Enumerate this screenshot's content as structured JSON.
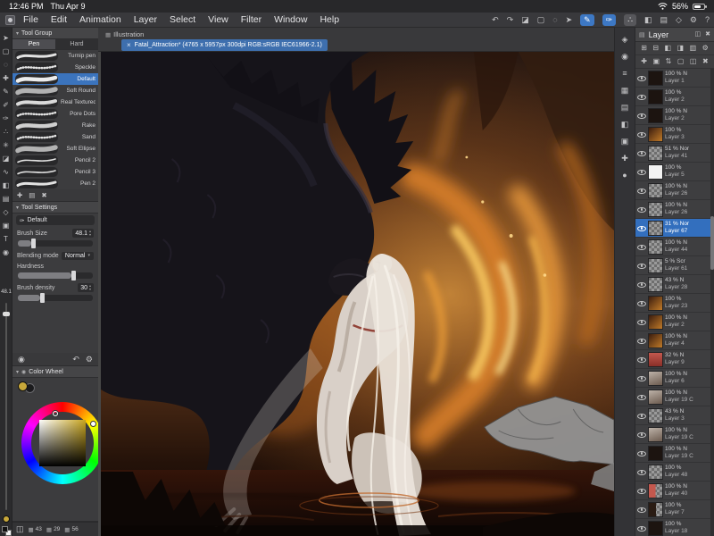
{
  "status_bar": {
    "time": "12:46 PM",
    "date": "Thu Apr 9",
    "battery_percent": "56%"
  },
  "menu_bar": {
    "items": [
      "File",
      "Edit",
      "Animation",
      "Layer",
      "Select",
      "View",
      "Filter",
      "Window",
      "Help"
    ],
    "right_icons": [
      {
        "name": "undo-icon",
        "glyph": "↶",
        "state": ""
      },
      {
        "name": "redo-icon",
        "glyph": "↷",
        "state": ""
      },
      {
        "name": "eraser-toggle-icon",
        "glyph": "◪",
        "state": ""
      },
      {
        "name": "marquee-icon",
        "glyph": "▢",
        "state": ""
      },
      {
        "name": "lasso-icon",
        "glyph": "◌",
        "state": ""
      },
      {
        "name": "object-icon",
        "glyph": "➤",
        "state": ""
      },
      {
        "name": "pen-tool-active-icon",
        "glyph": "✎",
        "state": "active"
      },
      {
        "name": "brush-tool-active-icon",
        "glyph": "✑",
        "state": "active"
      },
      {
        "name": "airbrush-pressed-icon",
        "glyph": "∴",
        "state": "pressed"
      },
      {
        "name": "fill-icon",
        "glyph": "◧",
        "state": ""
      },
      {
        "name": "gradient-icon",
        "glyph": "▤",
        "state": ""
      },
      {
        "name": "figure-icon",
        "glyph": "◇",
        "state": ""
      },
      {
        "name": "settings-gear-icon",
        "glyph": "⚙",
        "state": ""
      },
      {
        "name": "help-circle-icon",
        "glyph": "?",
        "state": ""
      }
    ]
  },
  "tab_strip": {
    "workspace_label": "Illustration",
    "workspace_icon": "▦",
    "doc_tab": {
      "close": "×",
      "title": "Fatal_Attraction* (4765 x 5957px 300dpi RGB:sRGB IEC61966-2.1)"
    }
  },
  "left_toolbar": {
    "tools": [
      {
        "name": "move-tool-icon",
        "glyph": "➤"
      },
      {
        "name": "selection-tool-icon",
        "glyph": "▢"
      },
      {
        "name": "lasso-tool-icon",
        "glyph": "◌"
      },
      {
        "name": "magic-wand-tool-icon",
        "glyph": "✚"
      },
      {
        "name": "pen-tool-icon",
        "glyph": "✎"
      },
      {
        "name": "pencil-tool-icon",
        "glyph": "✐"
      },
      {
        "name": "brush-tool-icon",
        "glyph": "✑"
      },
      {
        "name": "airbrush-tool-icon",
        "glyph": "∴"
      },
      {
        "name": "decoration-tool-icon",
        "glyph": "✳"
      },
      {
        "name": "eraser-tool-icon",
        "glyph": "◪"
      },
      {
        "name": "blend-tool-icon",
        "glyph": "∿"
      },
      {
        "name": "fill-tool-icon",
        "glyph": "◧"
      },
      {
        "name": "gradient-tool-icon",
        "glyph": "▤"
      },
      {
        "name": "shape-tool-icon",
        "glyph": "◇"
      },
      {
        "name": "frame-tool-icon",
        "glyph": "▣"
      },
      {
        "name": "text-tool-icon",
        "glyph": "T"
      },
      {
        "name": "eyedropper-tool-icon",
        "glyph": "◉"
      }
    ]
  },
  "side_slider": {
    "value": "48.1"
  },
  "tool_group": {
    "title": "Tool Group",
    "collapse_icon": "▾",
    "tabs": [
      {
        "label": "Pen",
        "active": true
      },
      {
        "label": "Hard",
        "active": false
      }
    ],
    "brushes": [
      {
        "name": "Turnip pen",
        "stroke": "taper"
      },
      {
        "name": "Speckle",
        "stroke": "dots"
      },
      {
        "name": "Default",
        "stroke": "smooth",
        "selected": true
      },
      {
        "name": "Soft Round",
        "stroke": "soft"
      },
      {
        "name": "Real Textured",
        "stroke": "rough"
      },
      {
        "name": "Pore Dots",
        "stroke": "dots"
      },
      {
        "name": "Rake",
        "stroke": "multi"
      },
      {
        "name": "Sand",
        "stroke": "dots"
      },
      {
        "name": "Soft Ellipse",
        "stroke": "soft"
      },
      {
        "name": "Pencil 2",
        "stroke": "thin"
      },
      {
        "name": "Pencil 3",
        "stroke": "thin"
      },
      {
        "name": "Pen 2",
        "stroke": "taper"
      }
    ],
    "footer_icons": [
      {
        "name": "add-brush-icon",
        "glyph": "✚"
      },
      {
        "name": "brush-menu-icon",
        "glyph": "▤"
      },
      {
        "name": "delete-brush-icon",
        "glyph": "✖"
      }
    ]
  },
  "tool_settings": {
    "title": "Tool Settings",
    "collapse_icon": "▾",
    "preset": "Default",
    "preset_icon": "✑",
    "brush_size": {
      "label": "Brush Size",
      "value": "48.1"
    },
    "blending": {
      "label": "Blending mode",
      "value": "Normal"
    },
    "hardness": {
      "label": "Hardness"
    },
    "density": {
      "label": "Brush density",
      "value": "30"
    },
    "footer_left": [
      {
        "name": "stroke-preview-icon",
        "glyph": "◉"
      }
    ],
    "footer_right": [
      {
        "name": "reset-settings-icon",
        "glyph": "↶"
      },
      {
        "name": "settings-wrench-icon",
        "glyph": "⚙"
      }
    ]
  },
  "color_wheel": {
    "title": "Color Wheel",
    "collapse_icon": "▾",
    "icon": "◉",
    "current_color": "#c8a83a"
  },
  "color_info": {
    "leading_icons": [
      {
        "name": "swatch-grid-icon",
        "glyph": "◫"
      }
    ],
    "values": [
      {
        "name": "color-metric-1",
        "icon": "▦",
        "value": "43"
      },
      {
        "name": "color-metric-2",
        "icon": "▦",
        "value": "29"
      },
      {
        "name": "color-metric-3",
        "icon": "▦",
        "value": "56"
      }
    ]
  },
  "right_dock": {
    "icons": [
      {
        "name": "quick-access-icon",
        "glyph": "◈"
      },
      {
        "name": "color-wheel-dock-icon",
        "glyph": "◉"
      },
      {
        "name": "color-slider-icon",
        "glyph": "≡"
      },
      {
        "name": "color-set-icon",
        "glyph": "▦"
      },
      {
        "name": "swatch-icon",
        "glyph": "▤"
      },
      {
        "name": "material-icon",
        "glyph": "◧"
      },
      {
        "name": "navigator-icon",
        "glyph": "▣"
      },
      {
        "name": "subtool-icon",
        "glyph": "✚"
      },
      {
        "name": "history-icon",
        "glyph": "●"
      }
    ]
  },
  "layers_panel": {
    "title": "Layer",
    "title_icon": "▤",
    "window_icons": [
      {
        "name": "collapse-panel-icon",
        "glyph": "◫"
      },
      {
        "name": "close-panel-icon",
        "glyph": "✖"
      }
    ],
    "toolbar_row1": [
      {
        "name": "blend-mode-icon",
        "glyph": "⊞"
      },
      {
        "name": "lock-layer-icon",
        "glyph": "⊟"
      },
      {
        "name": "lock-alpha-icon",
        "glyph": "◧"
      },
      {
        "name": "clip-to-layer-icon",
        "glyph": "◨"
      },
      {
        "name": "ruler-icon",
        "glyph": "▥"
      },
      {
        "name": "layer-settings-icon",
        "glyph": "⚙"
      }
    ],
    "toolbar_row2": [
      {
        "name": "new-layer-icon",
        "glyph": "✚"
      },
      {
        "name": "new-folder-icon",
        "glyph": "▣"
      },
      {
        "name": "transfer-down-icon",
        "glyph": "⇅"
      },
      {
        "name": "merge-down-icon",
        "glyph": "▢"
      },
      {
        "name": "layer-mask-icon",
        "glyph": "◫"
      },
      {
        "name": "delete-layer-icon",
        "glyph": "✖"
      }
    ],
    "layers": [
      {
        "opacity": "100 %",
        "mode": "N",
        "name": "Layer 1",
        "thumb": "dark"
      },
      {
        "opacity": "100 %",
        "mode": "",
        "name": "Layer 2",
        "thumb": "dark"
      },
      {
        "opacity": "100 %",
        "mode": "N",
        "name": "Layer 2",
        "thumb": "dark"
      },
      {
        "opacity": "100 %",
        "mode": "",
        "name": "Layer 3",
        "thumb": "fire"
      },
      {
        "opacity": "51 %",
        "mode": "Nor",
        "name": "Layer 41",
        "thumb": "checker"
      },
      {
        "opacity": "100 %",
        "mode": "",
        "name": "Layer 5",
        "thumb": "white"
      },
      {
        "opacity": "100 %",
        "mode": "N",
        "name": "Layer 26",
        "thumb": "checker"
      },
      {
        "opacity": "100 %",
        "mode": "N",
        "name": "Layer 26",
        "thumb": "checker"
      },
      {
        "opacity": "31 %",
        "mode": "Nor",
        "name": "Layer 67",
        "thumb": "checker",
        "selected": true
      },
      {
        "opacity": "100 %",
        "mode": "N",
        "name": "Layer 44",
        "thumb": "checker"
      },
      {
        "opacity": "5 %",
        "mode": "Scr",
        "name": "Layer 61",
        "thumb": "checker"
      },
      {
        "opacity": "43 %",
        "mode": "N",
        "name": "Layer 28",
        "thumb": "checker"
      },
      {
        "opacity": "100 %",
        "mode": "",
        "name": "Layer 23",
        "thumb": "fire"
      },
      {
        "opacity": "100 %",
        "mode": "N",
        "name": "Layer 2",
        "thumb": "fire"
      },
      {
        "opacity": "100 %",
        "mode": "N",
        "name": "Layer 4",
        "thumb": "fire"
      },
      {
        "opacity": "32 %",
        "mode": "N",
        "name": "Layer 9",
        "thumb": "red"
      },
      {
        "opacity": "100 %",
        "mode": "N",
        "name": "Layer 6",
        "thumb": "figure"
      },
      {
        "opacity": "100 %",
        "mode": "N",
        "name": "Layer 19 C",
        "thumb": "figure"
      },
      {
        "opacity": "43 %",
        "mode": "N",
        "name": "Layer 3",
        "thumb": "checker"
      },
      {
        "opacity": "100 %",
        "mode": "N",
        "name": "Layer 19 C",
        "thumb": "figure"
      },
      {
        "opacity": "100 %",
        "mode": "N",
        "name": "Layer 19 C",
        "thumb": "dark"
      },
      {
        "opacity": "100 %",
        "mode": "",
        "name": "Layer 48",
        "thumb": "checker"
      },
      {
        "opacity": "100 %",
        "mode": "N",
        "name": "Layer 40",
        "thumb": "red-half"
      },
      {
        "opacity": "100 %",
        "mode": "",
        "name": "Layer 7",
        "thumb": "half"
      },
      {
        "opacity": "100 %",
        "mode": "",
        "name": "Layer 18",
        "thumb": "dark"
      }
    ]
  }
}
